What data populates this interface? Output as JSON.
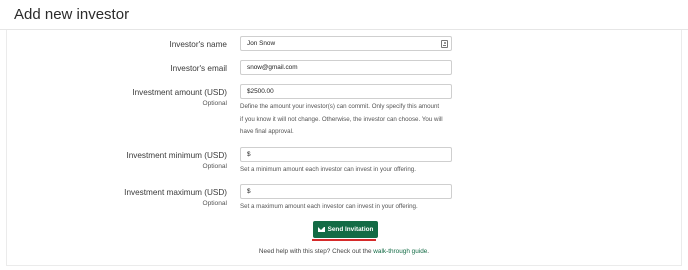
{
  "page_title": "Add new investor",
  "fields": {
    "name": {
      "label": "Investor's name",
      "value": "Jon Snow"
    },
    "email": {
      "label": "Investor's email",
      "value": "snow@gmail.com"
    },
    "amount": {
      "label": "Investment amount (USD)",
      "sublabel": "Optional",
      "value": "$2500.00",
      "help_lines": [
        "Define the amount your investor(s) can commit. Only specify this amount",
        "if you know it will not change. Otherwise, the investor can choose. You will",
        "have final approval."
      ]
    },
    "minimum": {
      "label": "Investment minimum (USD)",
      "sublabel": "Optional",
      "value": "$",
      "help": "Set a minimum amount each investor can invest in your offering."
    },
    "maximum": {
      "label": "Investment maximum (USD)",
      "sublabel": "Optional",
      "value": "$",
      "help": "Set a maximum amount each investor can invest in your offering."
    }
  },
  "send_button": {
    "label": "Send Invitation",
    "icon": "envelope-icon"
  },
  "footer": {
    "text": "Need help with this step? Check out the",
    "link": "walk-through guide",
    "end": "."
  },
  "colors": {
    "accent": "#136b45",
    "underline": "#d62a2a"
  }
}
